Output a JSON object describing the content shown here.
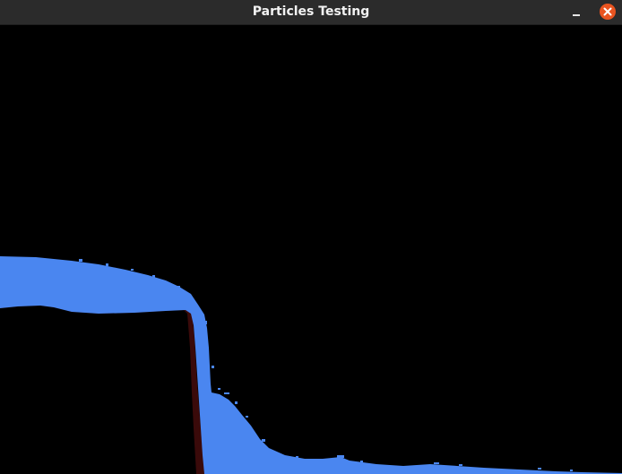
{
  "window": {
    "title": "Particles Testing"
  },
  "icons": {
    "minimize": "minimize-icon",
    "close": "close-icon"
  },
  "colors": {
    "titlebar": "#2b2b2b",
    "close_button": "#e95420",
    "background": "#000000",
    "water_particles": "#4a86f0",
    "wall_particles": "#3a0a0a"
  }
}
